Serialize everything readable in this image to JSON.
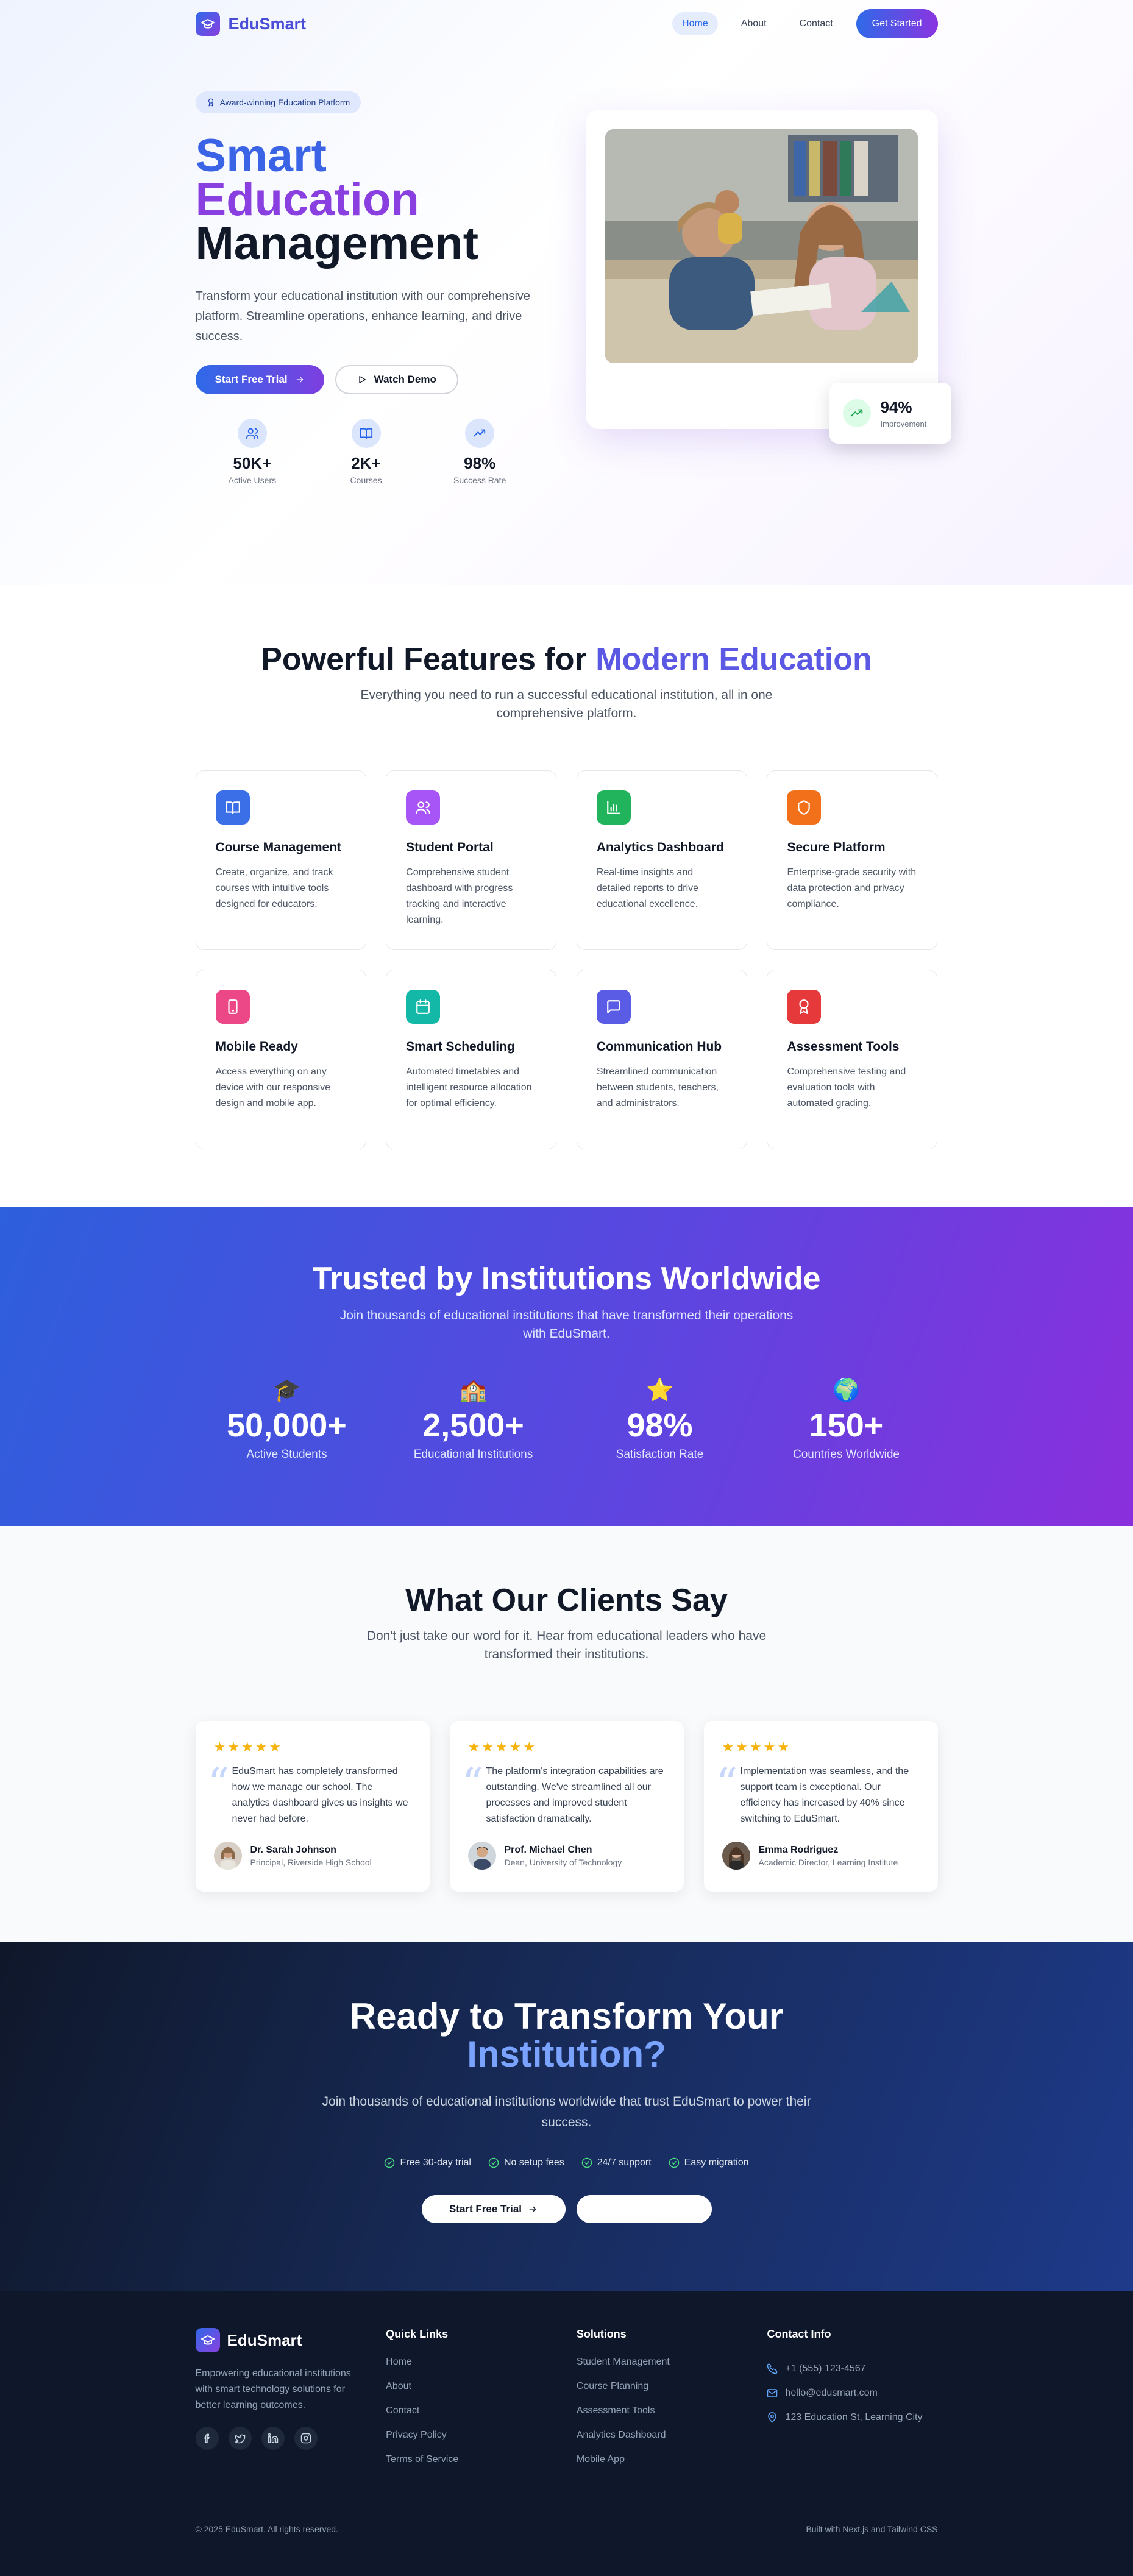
{
  "nav": {
    "brand": "EduSmart",
    "links": [
      "Home",
      "About",
      "Contact"
    ],
    "cta": "Get Started"
  },
  "hero": {
    "badge": "Award-winning Education Platform",
    "title_line1": "Smart",
    "title_line2": "Education",
    "title_line3": "Management",
    "description": "Transform your educational institution with our comprehensive platform. Streamline operations, enhance learning, and drive success.",
    "primary_button": "Start Free Trial",
    "secondary_button": "Watch Demo",
    "stats": [
      {
        "value": "50K+",
        "label": "Active Users",
        "icon": "users-icon"
      },
      {
        "value": "2K+",
        "label": "Courses",
        "icon": "book-icon"
      },
      {
        "value": "98%",
        "label": "Success Rate",
        "icon": "trending-icon"
      }
    ],
    "improvement": {
      "value": "94%",
      "label": "Improvement"
    }
  },
  "features": {
    "title": "Powerful Features for",
    "title_highlight": "Modern Education",
    "subtitle": "Everything you need to run a successful educational institution, all in one comprehensive platform.",
    "items": [
      {
        "title": "Course Management",
        "desc": "Create, organize, and track courses with intuitive tools designed for educators.",
        "color": "#3b6fe8",
        "icon": "book-icon"
      },
      {
        "title": "Student Portal",
        "desc": "Comprehensive student dashboard with progress tracking and interactive learning.",
        "color": "#a855f7",
        "icon": "users-icon"
      },
      {
        "title": "Analytics Dashboard",
        "desc": "Real-time insights and detailed reports to drive educational excellence.",
        "color": "#22b45c",
        "icon": "bar-chart-icon"
      },
      {
        "title": "Secure Platform",
        "desc": "Enterprise-grade security with data protection and privacy compliance.",
        "color": "#f2701a",
        "icon": "shield-icon"
      },
      {
        "title": "Mobile Ready",
        "desc": "Access everything on any device with our responsive design and mobile app.",
        "color": "#ec4888",
        "icon": "smartphone-icon"
      },
      {
        "title": "Smart Scheduling",
        "desc": "Automated timetables and intelligent resource allocation for optimal efficiency.",
        "color": "#14b8a6",
        "icon": "calendar-icon"
      },
      {
        "title": "Communication Hub",
        "desc": "Streamlined communication between students, teachers, and administrators.",
        "color": "#5b5ce6",
        "icon": "message-icon"
      },
      {
        "title": "Assessment Tools",
        "desc": "Comprehensive testing and evaluation tools with automated grading.",
        "color": "#e5393c",
        "icon": "award-icon"
      }
    ]
  },
  "trust": {
    "title": "Trusted by Institutions Worldwide",
    "subtitle": "Join thousands of educational institutions that have transformed their operations with EduSmart.",
    "stats": [
      {
        "emoji": "🎓",
        "value": "50,000+",
        "label": "Active Students"
      },
      {
        "emoji": "🏫",
        "value": "2,500+",
        "label": "Educational Institutions"
      },
      {
        "emoji": "⭐",
        "value": "98%",
        "label": "Satisfaction Rate"
      },
      {
        "emoji": "🌍",
        "value": "150+",
        "label": "Countries Worldwide"
      }
    ]
  },
  "testimonials": {
    "title": "What Our Clients Say",
    "subtitle": "Don't just take our word for it. Hear from educational leaders who have transformed their institutions.",
    "items": [
      {
        "stars": "★★★★★",
        "quote": "EduSmart has completely transformed how we manage our school. The analytics dashboard gives us insights we never had before.",
        "name": "Dr. Sarah Johnson",
        "role": "Principal, Riverside High School"
      },
      {
        "stars": "★★★★★",
        "quote": "The platform's integration capabilities are outstanding. We've streamlined all our processes and improved student satisfaction dramatically.",
        "name": "Prof. Michael Chen",
        "role": "Dean, University of Technology"
      },
      {
        "stars": "★★★★★",
        "quote": "Implementation was seamless, and the support team is exceptional. Our efficiency has increased by 40% since switching to EduSmart.",
        "name": "Emma Rodriguez",
        "role": "Academic Director, Learning Institute"
      }
    ]
  },
  "cta": {
    "title_line1": "Ready to Transform Your",
    "title_line2": "Institution?",
    "subtitle": "Join thousands of educational institutions worldwide that trust EduSmart to power their success.",
    "checks": [
      "Free 30-day trial",
      "No setup fees",
      "24/7 support",
      "Easy migration"
    ],
    "primary_button": "Start Free Trial",
    "secondary_button": ""
  },
  "footer": {
    "brand": "EduSmart",
    "description": "Empowering educational institutions with smart technology solutions for better learning outcomes.",
    "quick_links_title": "Quick Links",
    "quick_links": [
      "Home",
      "About",
      "Contact",
      "Privacy Policy",
      "Terms of Service"
    ],
    "solutions_title": "Solutions",
    "solutions": [
      "Student Management",
      "Course Planning",
      "Assessment Tools",
      "Analytics Dashboard",
      "Mobile App"
    ],
    "contact_title": "Contact Info",
    "phone": "+1 (555) 123-4567",
    "email": "hello@edusmart.com",
    "address": "123 Education St, Learning City",
    "copyright": "© 2025 EduSmart. All rights reserved.",
    "built_with": "Built with Next.js and Tailwind CSS"
  }
}
